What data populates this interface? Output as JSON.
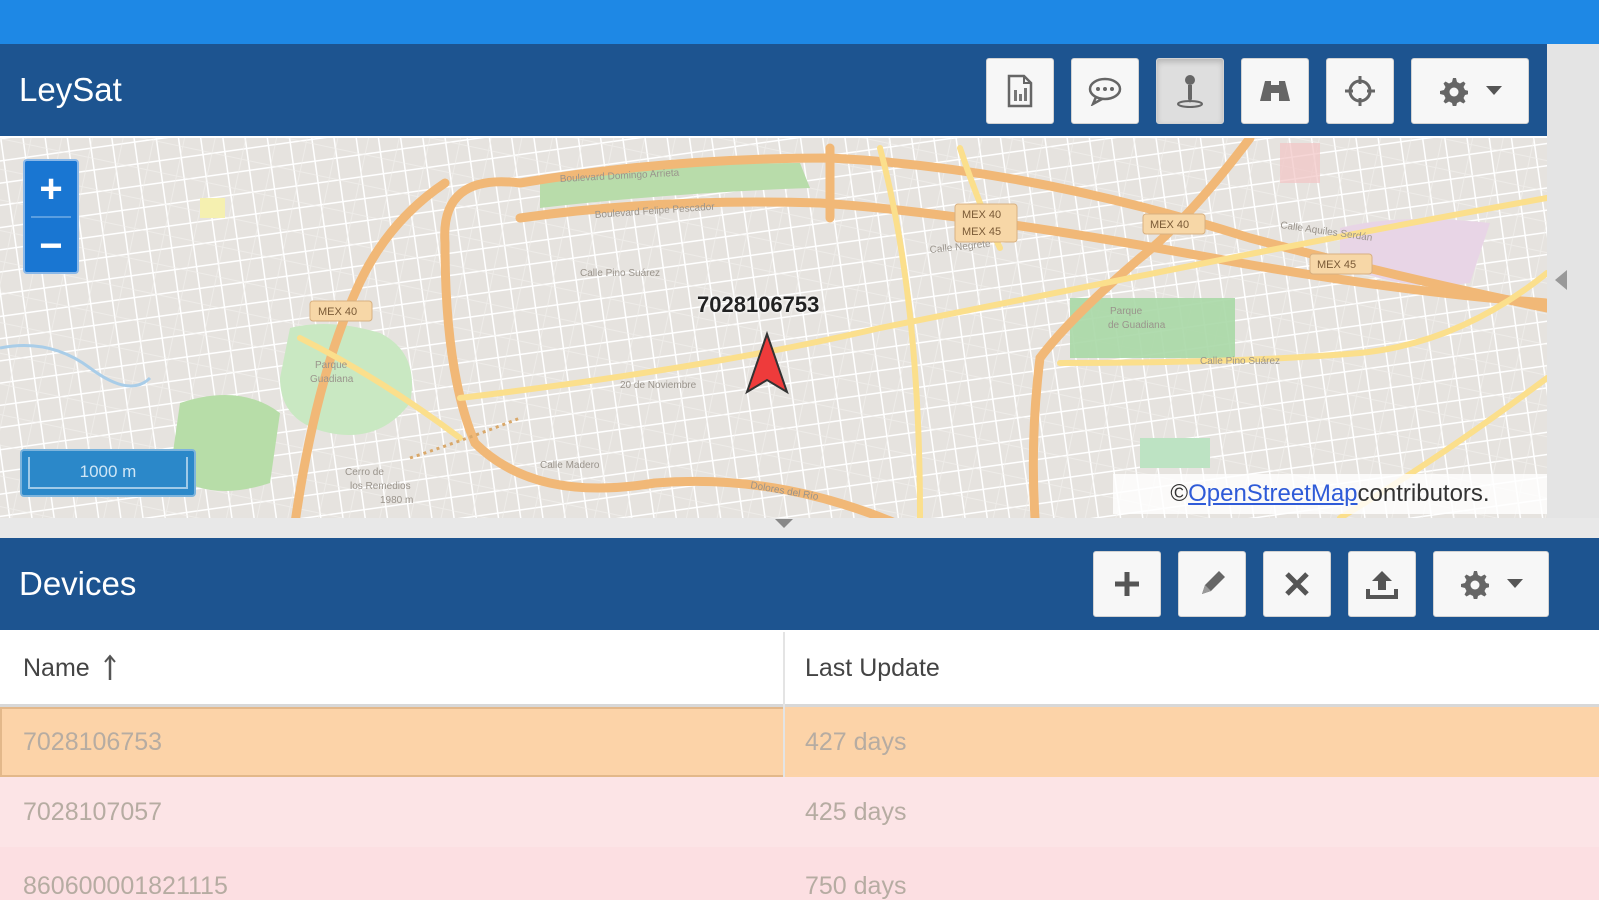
{
  "app": {
    "title": "LeySat"
  },
  "map_toolbar": {
    "icons": [
      "report-icon",
      "message-icon",
      "geofence-icon",
      "binoculars-icon",
      "crosshair-icon",
      "settings-icon",
      "caret-down-icon"
    ],
    "active": "geofence-icon"
  },
  "map": {
    "zoom_in": "+",
    "zoom_out": "−",
    "scale": "1000 m",
    "marker_label": "7028106753",
    "attribution_prefix": "© ",
    "attribution_link": "OpenStreetMap",
    "attribution_suffix": " contributors.",
    "road_badges": [
      "MEX 40",
      "MEX 40",
      "MEX 45",
      "MEX 40",
      "MEX 45"
    ]
  },
  "devices": {
    "title": "Devices",
    "toolbar_icons": [
      "plus-icon",
      "pencil-icon",
      "close-icon",
      "upload-icon",
      "settings-icon",
      "caret-down-icon"
    ],
    "columns": [
      "Name",
      "Last Update"
    ],
    "rows": [
      {
        "name": "7028106753",
        "last_update": "427 days",
        "color": "#fcd3a8"
      },
      {
        "name": "7028107057",
        "last_update": "425 days",
        "color": "#fce4e6"
      },
      {
        "name": "860600001821115",
        "last_update": "750 days",
        "color": "#fce4e6"
      }
    ]
  },
  "colors": {
    "topbar": "#1e88e5",
    "header": "#1d5490",
    "selected_row": "#fcd3a8",
    "stale_row": "#fce4e6",
    "marker": "#ee3b3b"
  }
}
